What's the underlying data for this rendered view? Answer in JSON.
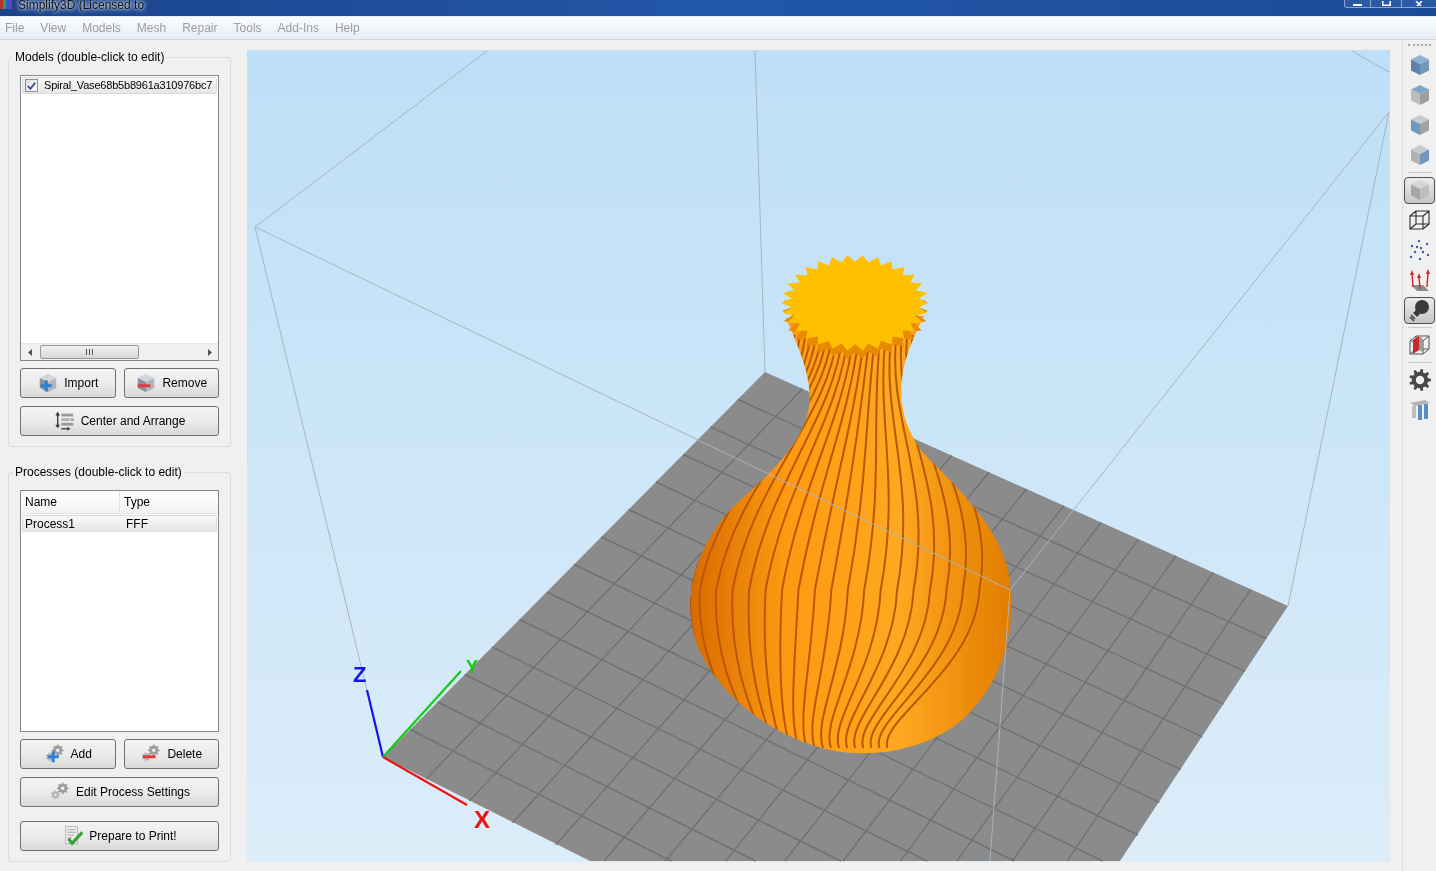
{
  "window": {
    "title": "Simplify3D (Licensed to"
  },
  "menu": [
    "File",
    "View",
    "Models",
    "Mesh",
    "Repair",
    "Tools",
    "Add-Ins",
    "Help"
  ],
  "models": {
    "title": "Models (double-click to edit)",
    "items": [
      {
        "name": "Spiral_Vase68b5b8961a310976bc7",
        "checked": true,
        "selected": true
      }
    ],
    "button_rows": [
      [
        {
          "kind": "import",
          "label": "Import"
        },
        {
          "kind": "remove",
          "label": "Remove"
        }
      ],
      [
        {
          "kind": "arrange",
          "label": "Center and Arrange"
        }
      ]
    ]
  },
  "processes": {
    "title": "Processes (double-click to edit)",
    "columns": [
      "Name",
      "Type"
    ],
    "rows": [
      {
        "cells": [
          "Process1",
          "FFF"
        ],
        "selected": true
      }
    ],
    "button_rows": [
      [
        {
          "kind": "add",
          "label": "Add"
        },
        {
          "kind": "delete",
          "label": "Delete"
        }
      ],
      [
        {
          "kind": "edit",
          "label": "Edit Process Settings"
        }
      ],
      [
        {
          "kind": "prepare",
          "label": "Prepare to Print!"
        }
      ]
    ]
  },
  "viewport": {
    "axes": [
      {
        "kind": "z",
        "label": "Z"
      },
      {
        "kind": "y",
        "label": "Y"
      },
      {
        "kind": "x",
        "label": "X"
      }
    ]
  },
  "toolbar": {
    "groups": [
      {
        "items": [
          {
            "kind": "iso",
            "selected": false
          },
          {
            "kind": "top",
            "selected": false
          },
          {
            "kind": "front",
            "selected": false
          },
          {
            "kind": "side",
            "selected": false
          }
        ]
      },
      {
        "items": [
          {
            "kind": "solid",
            "selected": true
          },
          {
            "kind": "wireframe",
            "selected": false
          },
          {
            "kind": "points",
            "selected": false
          },
          {
            "kind": "normals",
            "selected": false
          },
          {
            "kind": "lighting",
            "selected": true
          }
        ]
      },
      {
        "items": [
          {
            "kind": "section",
            "selected": false
          }
        ]
      },
      {
        "items": [
          {
            "kind": "settings",
            "selected": false
          },
          {
            "kind": "supports",
            "selected": false
          }
        ]
      }
    ]
  }
}
